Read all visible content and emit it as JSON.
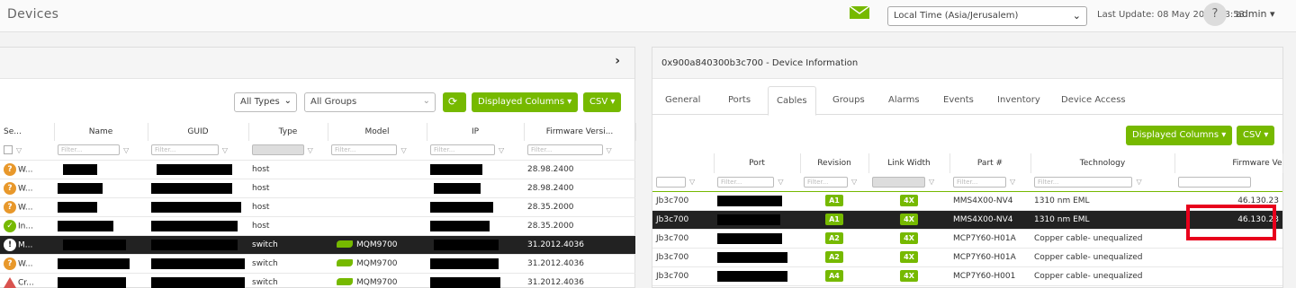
{
  "header": {
    "title": "Devices",
    "timezone": "Local Time (Asia/Jerusalem)",
    "last_update": "Last Update: 08 May 2024 18:53",
    "help": "?",
    "user": "admin"
  },
  "left": {
    "types_select": "All Types",
    "groups_select": "All Groups",
    "refresh_icon": "refresh-icon",
    "displayed_columns": "Displayed Columns",
    "csv": "CSV",
    "columns": [
      "Se...",
      "Name",
      "GUID",
      "Type",
      "Model",
      "IP",
      "Firmware Versi..."
    ],
    "filter_placeholder": "Filter...",
    "rows": [
      {
        "status": "warning",
        "sev": "W...",
        "type": "host",
        "model": "",
        "fw": "28.98.2400"
      },
      {
        "status": "warning",
        "sev": "W...",
        "type": "host",
        "model": "",
        "fw": "28.98.2400"
      },
      {
        "status": "warning",
        "sev": "W...",
        "type": "host",
        "model": "",
        "fw": "28.35.2000"
      },
      {
        "status": "ok",
        "sev": "In...",
        "type": "host",
        "model": "",
        "fw": "28.35.2000"
      },
      {
        "status": "critical",
        "sev": "M...",
        "type": "switch",
        "model": "MQM9700",
        "fw": "31.2012.4036"
      },
      {
        "status": "warning",
        "sev": "W...",
        "type": "switch",
        "model": "MQM9700",
        "fw": "31.2012.4036"
      },
      {
        "status": "error",
        "sev": "Cr...",
        "type": "switch",
        "model": "MQM9700",
        "fw": "31.2012.4036"
      }
    ]
  },
  "right": {
    "title": "0x900a840300b3c700 - Device Information",
    "tabs": [
      "General",
      "Ports",
      "Cables",
      "Groups",
      "Alarms",
      "Events",
      "Inventory",
      "Device Access"
    ],
    "active_tab": "Cables",
    "displayed_columns": "Displayed Columns",
    "csv": "CSV",
    "columns": [
      "",
      "Port",
      "Revision",
      "Link Width",
      "Part #",
      "Technology",
      "Firmware Ve"
    ],
    "filter_placeholder": "Filter...",
    "rows": [
      {
        "guid": "Jb3c700",
        "rev": "A1",
        "width": "4X",
        "part": "MMS4X00-NV4",
        "tech": "1310 nm EML",
        "fw": "46.130.23"
      },
      {
        "guid": "Jb3c700",
        "rev": "A1",
        "width": "4X",
        "part": "MMS4X00-NV4",
        "tech": "1310 nm EML",
        "fw": "46.130.23"
      },
      {
        "guid": "Jb3c700",
        "rev": "A2",
        "width": "4X",
        "part": "MCP7Y60-H01A",
        "tech": "Copper cable- unequalized",
        "fw": ""
      },
      {
        "guid": "Jb3c700",
        "rev": "A2",
        "width": "4X",
        "part": "MCP7Y60-H01A",
        "tech": "Copper cable- unequalized",
        "fw": ""
      },
      {
        "guid": "Jb3c700",
        "rev": "A4",
        "width": "4X",
        "part": "MCP7Y60-H001",
        "tech": "Copper cable- unequalized",
        "fw": ""
      }
    ]
  },
  "colors": {
    "accent": "#76b900",
    "warning": "#e8982b",
    "error": "#d9534f",
    "highlight": "#e8001c",
    "selected_row": "#222222"
  }
}
